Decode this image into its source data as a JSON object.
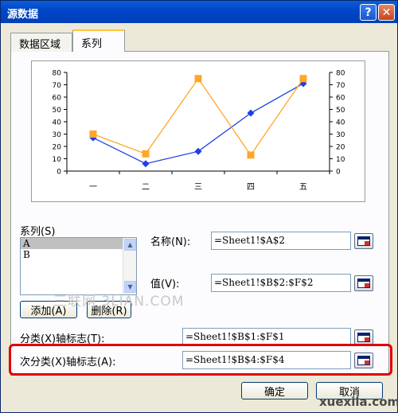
{
  "window": {
    "title": "源数据",
    "help_btn": "?",
    "close_btn": "✕"
  },
  "tabs": [
    {
      "label": "数据区域",
      "active": false
    },
    {
      "label": "系列",
      "active": true
    }
  ],
  "chart_data": {
    "type": "line",
    "categories": [
      "一",
      "二",
      "三",
      "四",
      "五"
    ],
    "series": [
      {
        "name": "A",
        "values": [
          27,
          6,
          16,
          47,
          71
        ],
        "color": "#1f3ee6",
        "marker": "diamond"
      },
      {
        "name": "B",
        "values": [
          30,
          14,
          75,
          13,
          75
        ],
        "color": "#ffa726",
        "marker": "square"
      }
    ],
    "ylim": [
      0,
      80
    ],
    "y_ticks": [
      "0",
      "10",
      "20",
      "30",
      "40",
      "50",
      "60",
      "70",
      "80"
    ],
    "secondary_y_ticks": [
      "0",
      "10",
      "20",
      "30",
      "40",
      "50",
      "60",
      "70",
      "80"
    ],
    "grid": false
  },
  "series_section": {
    "label": "系列(S)",
    "items": [
      {
        "label": "A",
        "selected": true
      },
      {
        "label": "B",
        "selected": false
      }
    ],
    "add_button": "添加(A)",
    "remove_button": "删除(R)"
  },
  "name_field": {
    "label": "名称(N):",
    "value": "=Sheet1!$A$2"
  },
  "value_field": {
    "label": "值(V):",
    "value": "=Sheet1!$B$2:$F$2"
  },
  "category_axis": {
    "label": "分类(X)轴标志(T):",
    "value": "=Sheet1!$B$1:$F$1"
  },
  "secondary_category_axis": {
    "label": "次分类(X)轴标志(A):",
    "value": "=Sheet1!$B$4:$F$4"
  },
  "buttons": {
    "ok": "确定",
    "cancel": "取消"
  },
  "watermarks": {
    "left": "三联网 3LIAN.COM",
    "right": "xuexila.com"
  },
  "icons": {
    "collapse": "collapse-dialog-icon",
    "scroll_up": "scroll-up-icon",
    "scroll_down": "scroll-down-icon"
  }
}
